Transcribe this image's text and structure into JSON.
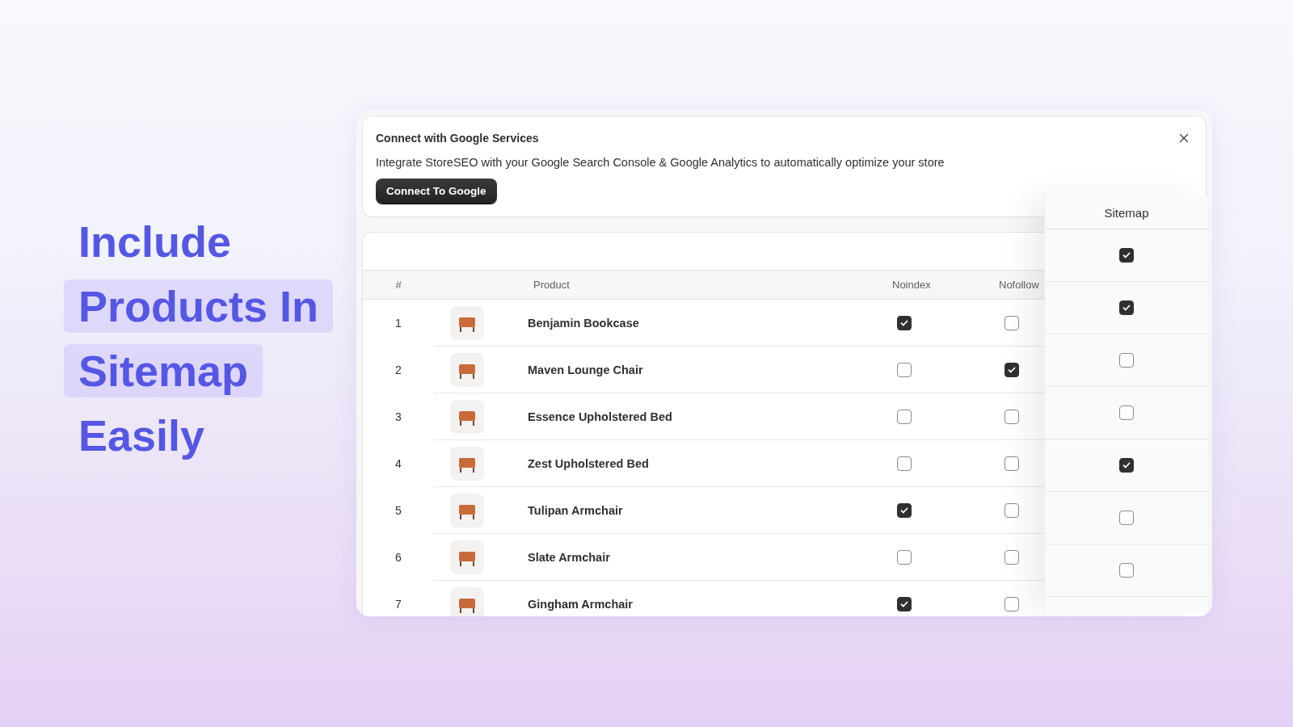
{
  "headline": [
    {
      "text": "Include",
      "highlighted": false
    },
    {
      "text": "Products In",
      "highlighted": true
    },
    {
      "text": "Sitemap",
      "highlighted": true
    },
    {
      "text": "Easily",
      "highlighted": false
    }
  ],
  "banner": {
    "title": "Connect with Google Services",
    "description": "Integrate StoreSEO with your Google Search Console & Google Analytics to automatically optimize your store",
    "button": "Connect To Google"
  },
  "table": {
    "columns": [
      "#",
      "Product",
      "Noindex",
      "Nofollow"
    ],
    "rows": [
      {
        "number": "1",
        "product": "Benjamin Bookcase",
        "noindex": true,
        "nofollow": false
      },
      {
        "number": "2",
        "product": "Maven Lounge Chair",
        "noindex": false,
        "nofollow": true
      },
      {
        "number": "3",
        "product": "Essence Upholstered Bed",
        "noindex": false,
        "nofollow": false
      },
      {
        "number": "4",
        "product": "Zest Upholstered Bed",
        "noindex": false,
        "nofollow": false
      },
      {
        "number": "5",
        "product": "Tulipan Armchair",
        "noindex": true,
        "nofollow": false
      },
      {
        "number": "6",
        "product": "Slate Armchair",
        "noindex": false,
        "nofollow": false
      },
      {
        "number": "7",
        "product": "Gingham Armchair",
        "noindex": true,
        "nofollow": false
      }
    ]
  },
  "sitemap": {
    "title": "Sitemap",
    "rows": [
      {
        "checked": true
      },
      {
        "checked": true
      },
      {
        "checked": false
      },
      {
        "checked": false
      },
      {
        "checked": true
      },
      {
        "checked": false
      },
      {
        "checked": false
      }
    ]
  }
}
